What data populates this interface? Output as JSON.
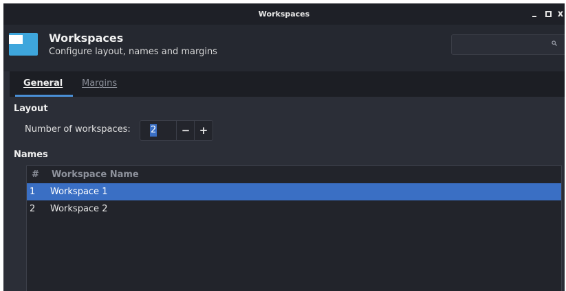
{
  "window": {
    "title": "Workspaces",
    "minimize": "_",
    "maximize": "□",
    "close": "x"
  },
  "header": {
    "title": "Workspaces",
    "subtitle": "Configure layout, names and margins",
    "search_placeholder": ""
  },
  "icons": {
    "app": "workspaces-app-icon",
    "search": "search-icon"
  },
  "tabs": [
    {
      "label": "General",
      "active": true
    },
    {
      "label": "Margins",
      "active": false
    }
  ],
  "layout": {
    "section_label": "Layout",
    "workspaces_label": "Number of workspaces:",
    "workspaces_value": "2",
    "minus": "−",
    "plus": "+"
  },
  "names": {
    "section_label": "Names",
    "columns": [
      "#",
      "Workspace Name"
    ],
    "rows": [
      {
        "num": "1",
        "name": "Workspace 1",
        "selected": true
      },
      {
        "num": "2",
        "name": "Workspace 2",
        "selected": false
      }
    ]
  },
  "colors": {
    "accent": "#3a6fc4",
    "tab_indicator": "#4a8fd6",
    "app_icon": "#3ea6dc",
    "background": "#2b2e37"
  }
}
